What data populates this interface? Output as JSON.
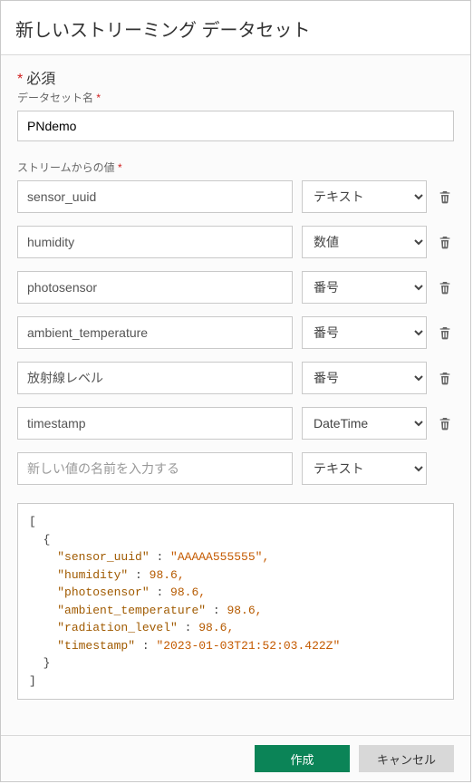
{
  "header": {
    "title": "新しいストリーミング データセット"
  },
  "required": {
    "label": "必須",
    "asterisk": "*"
  },
  "dataset_name": {
    "label": "データセット名",
    "asterisk": "*",
    "value": "PNdemo"
  },
  "stream_values": {
    "label": "ストリームからの値",
    "asterisk": "*"
  },
  "fields": [
    {
      "name": "sensor_uuid",
      "type": "テキスト"
    },
    {
      "name": "humidity",
      "type": "数値"
    },
    {
      "name": "photosensor",
      "type": "番号"
    },
    {
      "name": "ambient_temperature",
      "type": "番号"
    },
    {
      "name": "放射線レベル",
      "type": "番号"
    },
    {
      "name": "timestamp",
      "type": "DateTime"
    }
  ],
  "new_field": {
    "placeholder": "新しい値の名前を入力する",
    "type": "テキスト"
  },
  "preview": {
    "lines": [
      {
        "indent": 0,
        "text": "["
      },
      {
        "indent": 1,
        "text": "{"
      },
      {
        "indent": 2,
        "key": "sensor_uuid",
        "sep": " : ",
        "val": "\"AAAAA555555\"",
        "valClass": "str",
        "comma": true
      },
      {
        "indent": 2,
        "key": "humidity",
        "sep": " : ",
        "val": "98.6",
        "valClass": "num",
        "comma": true
      },
      {
        "indent": 2,
        "key": "photosensor",
        "sep": " : ",
        "val": "98.6",
        "valClass": "num",
        "comma": true
      },
      {
        "indent": 2,
        "key": "ambient_temperature",
        "sep": " : ",
        "val": "98.6",
        "valClass": "num",
        "comma": true
      },
      {
        "indent": 2,
        "key": "radiation_level",
        "sep": " : ",
        "val": "98.6",
        "valClass": "num",
        "comma": true
      },
      {
        "indent": 2,
        "key": "timestamp",
        "sep": " : ",
        "val": "\"2023-01-03T21:52:03.422Z\"",
        "valClass": "str",
        "comma": false
      },
      {
        "indent": 1,
        "text": "}"
      },
      {
        "indent": 0,
        "text": "]"
      }
    ]
  },
  "footer": {
    "create": "作成",
    "cancel": "キャンセル"
  }
}
